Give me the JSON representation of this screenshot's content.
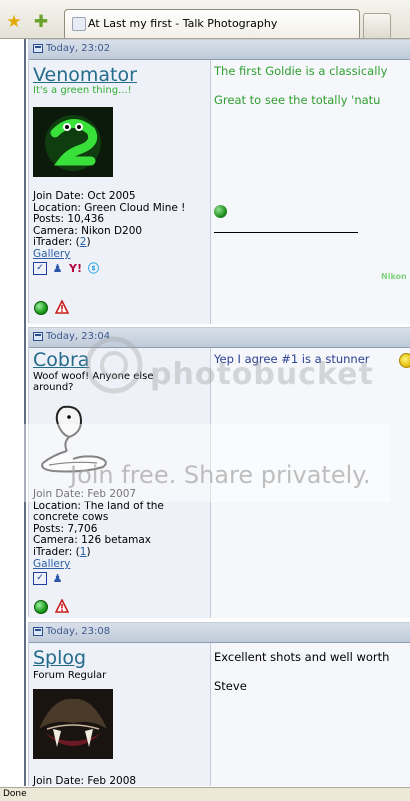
{
  "browser": {
    "tab_title": "At Last my first - Talk Photography",
    "status": "Done",
    "icons": [
      "bookmark-star-icon",
      "add-bookmark-icon",
      "tab-favicon"
    ]
  },
  "posts": [
    {
      "date": "Today, 23:02",
      "username": "Venomator",
      "user_title": "It's a green thing...!",
      "join_date": "Join Date: Oct 2005",
      "location": "Location: Green Cloud Mine !",
      "posts": "Posts: 10,436",
      "camera": "Camera: Nikon D200",
      "itrader_label": "iTrader: (",
      "itrader_count": "2",
      "itrader_close": ")",
      "gallery": "Gallery",
      "message_lines": [
        "The first Goldie is a classically",
        "Great to see the totally 'natu"
      ],
      "signature_fragment": "Nikon",
      "colors": {
        "title": "#33b033",
        "message": "#2f9f2f"
      }
    },
    {
      "date": "Today, 23:04",
      "username": "Cobra",
      "user_title_lines": [
        "Woof woof! Anyone else",
        "around?"
      ],
      "join_date": "Join Date: Feb 2007",
      "location_lines": [
        "Location: The land of the",
        "concrete cows"
      ],
      "posts": "Posts: 7,706",
      "camera": "Camera: 126 betamax",
      "itrader_label": "iTrader: (",
      "itrader_count": "1",
      "itrader_close": ")",
      "gallery": "Gallery",
      "message_lines": [
        "Yep I agree #1 is a stunner"
      ]
    },
    {
      "date": "Today, 23:08",
      "username": "Splog",
      "user_title": "Forum Regular",
      "join_date": "Join Date: Feb 2008",
      "message_lines": [
        "Excellent shots and well worth",
        "Steve"
      ]
    }
  ],
  "watermark": {
    "logo": "photobucket",
    "text": "Join free. Share privately."
  }
}
